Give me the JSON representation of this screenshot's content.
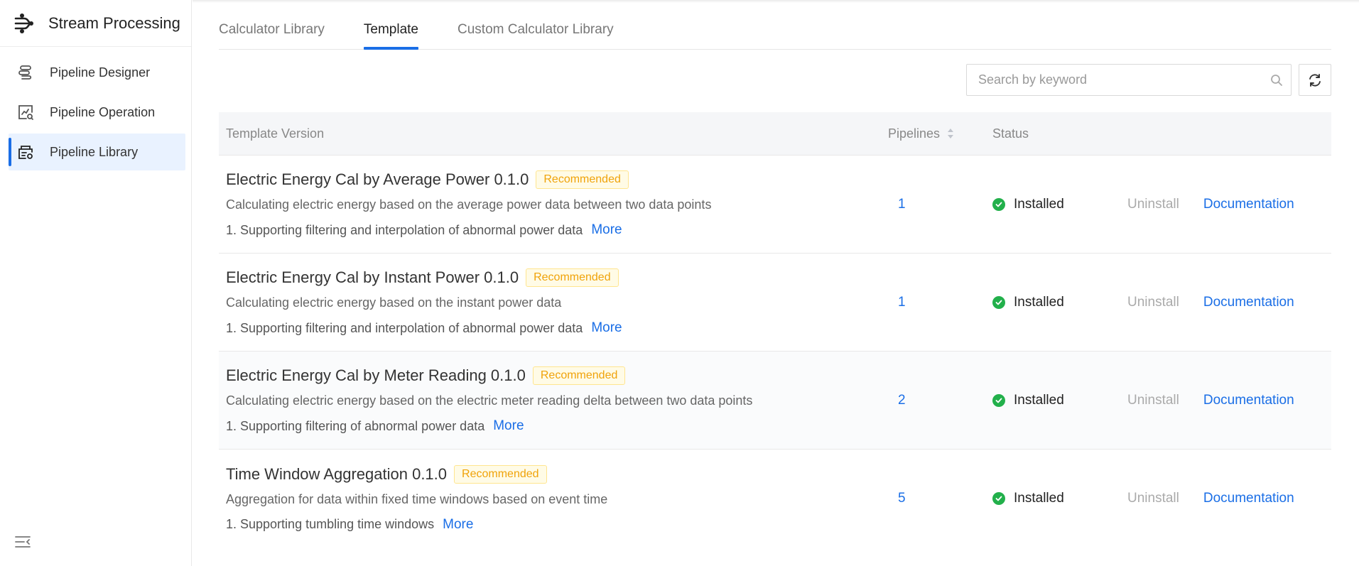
{
  "sidebar": {
    "app_title": "Stream Processing",
    "items": [
      {
        "label": "Pipeline Designer",
        "icon": "pipeline-designer-icon",
        "active": false
      },
      {
        "label": "Pipeline Operation",
        "icon": "pipeline-operation-icon",
        "active": false
      },
      {
        "label": "Pipeline Library",
        "icon": "pipeline-library-icon",
        "active": true
      }
    ]
  },
  "tabs": [
    {
      "label": "Calculator Library",
      "active": false
    },
    {
      "label": "Template",
      "active": true
    },
    {
      "label": "Custom Calculator Library",
      "active": false
    }
  ],
  "search": {
    "placeholder": "Search by keyword",
    "value": ""
  },
  "table": {
    "headers": {
      "version": "Template Version",
      "pipelines": "Pipelines",
      "status": "Status"
    },
    "rows": [
      {
        "title": "Electric Energy Cal by Average Power 0.1.0",
        "badge": "Recommended",
        "description": "Calculating electric energy based on the average power data between two data points",
        "feature": "1. Supporting filtering and interpolation of abnormal power data",
        "more": "More",
        "pipelines": "1",
        "status": "Installed",
        "uninstall": "Uninstall",
        "documentation": "Documentation"
      },
      {
        "title": "Electric Energy Cal by Instant Power 0.1.0",
        "badge": "Recommended",
        "description": "Calculating electric energy based on the instant power data",
        "feature": "1. Supporting filtering and interpolation of abnormal power data",
        "more": "More",
        "pipelines": "1",
        "status": "Installed",
        "uninstall": "Uninstall",
        "documentation": "Documentation"
      },
      {
        "title": "Electric Energy Cal by Meter Reading 0.1.0",
        "badge": "Recommended",
        "description": "Calculating electric energy based on the electric meter reading delta between two data points",
        "feature": "1. Supporting filtering of abnormal power data",
        "more": "More",
        "pipelines": "2",
        "status": "Installed",
        "uninstall": "Uninstall",
        "documentation": "Documentation"
      },
      {
        "title": "Time Window Aggregation 0.1.0",
        "badge": "Recommended",
        "description": "Aggregation for data within fixed time windows based on event time",
        "feature": "1. Supporting tumbling time windows",
        "more": "More",
        "pipelines": "5",
        "status": "Installed",
        "uninstall": "Uninstall",
        "documentation": "Documentation"
      }
    ]
  },
  "colors": {
    "accent": "#1a6ee6",
    "success": "#22b04b",
    "badge": "#f0a30a"
  }
}
